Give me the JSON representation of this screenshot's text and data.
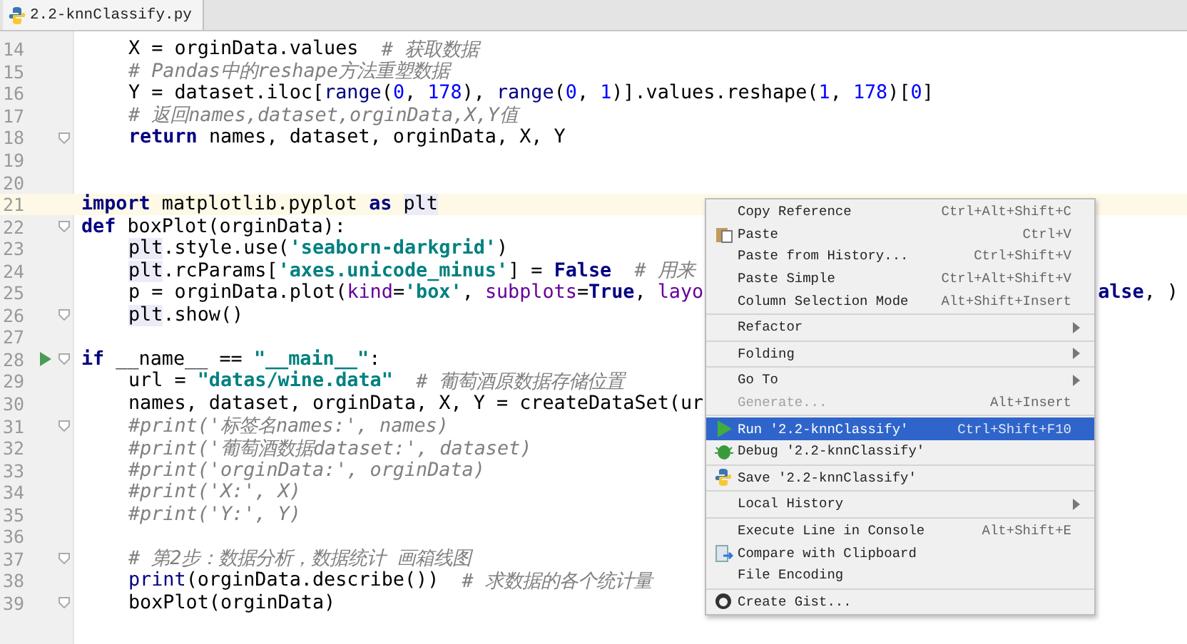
{
  "tabs": [
    {
      "label": "2.2-knnClassify.py",
      "selected": true
    }
  ],
  "editor": {
    "lines": [
      {
        "number": "14",
        "indented": true,
        "fold": false,
        "run": false,
        "current": false,
        "tokens": [
          {
            "kind": "plain",
            "text": "X = orginData.values  "
          },
          {
            "kind": "comment",
            "text": "# 获取数据"
          }
        ]
      },
      {
        "number": "15",
        "indented": true,
        "fold": false,
        "run": false,
        "current": false,
        "tokens": [
          {
            "kind": "comment",
            "text": "# Pandas中的reshape方法重塑数据"
          }
        ]
      },
      {
        "number": "16",
        "indented": true,
        "fold": false,
        "run": false,
        "current": false,
        "tokens": [
          {
            "kind": "plain",
            "text": "Y = dataset.iloc["
          },
          {
            "kind": "builtin",
            "text": "range"
          },
          {
            "kind": "plain",
            "text": "("
          },
          {
            "kind": "number",
            "text": "0"
          },
          {
            "kind": "plain",
            "text": ", "
          },
          {
            "kind": "number",
            "text": "178"
          },
          {
            "kind": "plain",
            "text": "), "
          },
          {
            "kind": "builtin",
            "text": "range"
          },
          {
            "kind": "plain",
            "text": "("
          },
          {
            "kind": "number",
            "text": "0"
          },
          {
            "kind": "plain",
            "text": ", "
          },
          {
            "kind": "number",
            "text": "1"
          },
          {
            "kind": "plain",
            "text": ")].values.reshape("
          },
          {
            "kind": "number",
            "text": "1"
          },
          {
            "kind": "plain",
            "text": ", "
          },
          {
            "kind": "number",
            "text": "178"
          },
          {
            "kind": "plain",
            "text": ")["
          },
          {
            "kind": "number",
            "text": "0"
          },
          {
            "kind": "plain",
            "text": "]"
          }
        ]
      },
      {
        "number": "17",
        "indented": true,
        "fold": false,
        "run": false,
        "current": false,
        "tokens": [
          {
            "kind": "comment",
            "text": "# 返回names,dataset,orginData,X,Y值"
          }
        ]
      },
      {
        "number": "18",
        "indented": true,
        "fold": true,
        "run": false,
        "current": false,
        "tokens": [
          {
            "kind": "keyword",
            "text": "return "
          },
          {
            "kind": "plain",
            "text": "names, dataset, orginData, X, Y"
          }
        ]
      },
      {
        "number": "19",
        "fold": false,
        "run": false,
        "current": false
      },
      {
        "number": "20",
        "fold": false,
        "run": false,
        "current": false
      },
      {
        "number": "21",
        "indented": false,
        "fold": false,
        "run": false,
        "current": true,
        "tokens": [
          {
            "kind": "keyword",
            "text": "import"
          },
          {
            "kind": "plain",
            "text": " matplotlib.pyplot "
          },
          {
            "kind": "keyword",
            "text": "as "
          },
          {
            "kind": "usage",
            "text": "plt"
          }
        ]
      },
      {
        "number": "22",
        "indented": false,
        "fold": true,
        "run": false,
        "current": false,
        "tokens": [
          {
            "kind": "keyword",
            "text": "def"
          },
          {
            "kind": "plain",
            "text": " boxPlot(orginData):"
          }
        ]
      },
      {
        "number": "23",
        "indented": true,
        "fold": false,
        "run": false,
        "current": false,
        "tokens": [
          {
            "kind": "usage",
            "text": "plt"
          },
          {
            "kind": "plain",
            "text": ".style.use("
          },
          {
            "kind": "string",
            "text": "'seaborn-darkgrid'"
          },
          {
            "kind": "plain",
            "text": ")"
          }
        ]
      },
      {
        "number": "24",
        "indented": true,
        "fold": false,
        "run": false,
        "current": false,
        "tokens": [
          {
            "kind": "usage",
            "text": "plt"
          },
          {
            "kind": "plain",
            "text": ".rcParams["
          },
          {
            "kind": "string",
            "text": "'axes.unicode_minus'"
          },
          {
            "kind": "plain",
            "text": "] = "
          },
          {
            "kind": "keyword",
            "text": "False  "
          },
          {
            "kind": "comment",
            "text": "# 用来"
          }
        ]
      },
      {
        "number": "25",
        "indented": true,
        "fold": false,
        "run": false,
        "current": false,
        "tokens": [
          {
            "kind": "plain",
            "text": "p = orginData.plot("
          },
          {
            "kind": "param",
            "text": "kind"
          },
          {
            "kind": "plain",
            "text": "="
          },
          {
            "kind": "string",
            "text": "'box'"
          },
          {
            "kind": "plain",
            "text": ", "
          },
          {
            "kind": "param",
            "text": "subplots"
          },
          {
            "kind": "plain",
            "text": "="
          },
          {
            "kind": "keyword",
            "text": "True"
          },
          {
            "kind": "plain",
            "text": ", "
          },
          {
            "kind": "param",
            "text": "layo"
          }
        ],
        "tail": [
          {
            "kind": "keyword",
            "text": "alse"
          },
          {
            "kind": "plain",
            "text": ", )"
          }
        ]
      },
      {
        "number": "26",
        "indented": true,
        "fold": true,
        "run": false,
        "current": false,
        "tokens": [
          {
            "kind": "usage",
            "text": "plt"
          },
          {
            "kind": "plain",
            "text": ".show()"
          }
        ]
      },
      {
        "number": "27",
        "fold": false,
        "run": false,
        "current": false
      },
      {
        "number": "28",
        "indented": false,
        "fold": true,
        "run": true,
        "current": false,
        "tokens": [
          {
            "kind": "keyword",
            "text": "if"
          },
          {
            "kind": "plain",
            "text": " __name__ == "
          },
          {
            "kind": "string",
            "text": "\"__main__\""
          },
          {
            "kind": "plain",
            "text": ":"
          }
        ]
      },
      {
        "number": "29",
        "indented": true,
        "fold": false,
        "run": false,
        "current": false,
        "tokens": [
          {
            "kind": "plain",
            "text": "url = "
          },
          {
            "kind": "string",
            "text": "\"datas/wine.data\"  "
          },
          {
            "kind": "comment",
            "text": "# 葡萄酒原数据存储位置"
          }
        ]
      },
      {
        "number": "30",
        "indented": true,
        "fold": false,
        "run": false,
        "current": false,
        "tokens": [
          {
            "kind": "plain",
            "text": "names, dataset, orginData, X, Y = createDataSet(ur"
          }
        ]
      },
      {
        "number": "31",
        "indented": true,
        "fold": true,
        "run": false,
        "current": false,
        "tokens": [
          {
            "kind": "comment",
            "text": "#print('标签名names:', names)"
          }
        ]
      },
      {
        "number": "32",
        "indented": true,
        "fold": false,
        "run": false,
        "current": false,
        "tokens": [
          {
            "kind": "comment",
            "text": "#print('葡萄酒数据dataset:', dataset)"
          }
        ]
      },
      {
        "number": "33",
        "indented": true,
        "fold": false,
        "run": false,
        "current": false,
        "tokens": [
          {
            "kind": "comment",
            "text": "#print('orginData:', orginData)"
          }
        ]
      },
      {
        "number": "34",
        "indented": true,
        "fold": false,
        "run": false,
        "current": false,
        "tokens": [
          {
            "kind": "comment",
            "text": "#print('X:', X)"
          }
        ]
      },
      {
        "number": "35",
        "indented": true,
        "fold": false,
        "run": false,
        "current": false,
        "tokens": [
          {
            "kind": "comment",
            "text": "#print('Y:', Y)"
          }
        ]
      },
      {
        "number": "36",
        "fold": false,
        "run": false,
        "current": false
      },
      {
        "number": "37",
        "indented": true,
        "fold": true,
        "run": false,
        "current": false,
        "tokens": [
          {
            "kind": "comment",
            "text": "# 第2步：数据分析，数据统计 画箱线图"
          }
        ]
      },
      {
        "number": "38",
        "indented": true,
        "fold": false,
        "run": false,
        "current": false,
        "tokens": [
          {
            "kind": "builtin",
            "text": "print"
          },
          {
            "kind": "plain",
            "text": "(orginData.describe())  "
          },
          {
            "kind": "comment",
            "text": "# 求数据的各个统计量"
          }
        ]
      },
      {
        "number": "39",
        "indented": true,
        "fold": true,
        "run": false,
        "current": false,
        "tokens": [
          {
            "kind": "plain",
            "text": "boxPlot(orginData)"
          }
        ]
      }
    ]
  },
  "context_menu": {
    "items": [
      {
        "kind": "plain",
        "label": "Copy Reference",
        "shortcut": "Ctrl+Alt+Shift+C",
        "submenu": false,
        "disabled": false,
        "selected": false
      },
      {
        "kind": "paste",
        "label": "Paste",
        "shortcut": "Ctrl+V",
        "submenu": false,
        "disabled": false,
        "selected": false
      },
      {
        "kind": "plain",
        "label": "Paste from History...",
        "shortcut": "Ctrl+Shift+V",
        "submenu": false,
        "disabled": false,
        "selected": false
      },
      {
        "kind": "plain",
        "label": "Paste Simple",
        "shortcut": "Ctrl+Alt+Shift+V",
        "submenu": false,
        "disabled": false,
        "selected": false
      },
      {
        "kind": "plain",
        "label": "Column Selection Mode",
        "shortcut": "Alt+Shift+Insert",
        "submenu": false,
        "disabled": false,
        "selected": false
      },
      {
        "kind": "separator"
      },
      {
        "kind": "plain",
        "label": "Refactor",
        "submenu": true,
        "disabled": false,
        "selected": false
      },
      {
        "kind": "separator"
      },
      {
        "kind": "plain",
        "label": "Folding",
        "submenu": true,
        "disabled": false,
        "selected": false
      },
      {
        "kind": "separator"
      },
      {
        "kind": "plain",
        "label": "Go To",
        "submenu": true,
        "disabled": false,
        "selected": false
      },
      {
        "kind": "plain",
        "label": "Generate...",
        "shortcut": "Alt+Insert",
        "submenu": false,
        "disabled": true,
        "selected": false
      },
      {
        "kind": "separator"
      },
      {
        "kind": "run",
        "label": "Run '2.2-knnClassify'",
        "shortcut": "Ctrl+Shift+F10",
        "submenu": false,
        "disabled": false,
        "selected": true
      },
      {
        "kind": "debug",
        "label": "Debug '2.2-knnClassify'",
        "submenu": false,
        "disabled": false,
        "selected": false
      },
      {
        "kind": "separator"
      },
      {
        "kind": "python",
        "label": "Save '2.2-knnClassify'",
        "submenu": false,
        "disabled": false,
        "selected": false
      },
      {
        "kind": "separator"
      },
      {
        "kind": "plain",
        "label": "Local History",
        "submenu": true,
        "disabled": false,
        "selected": false
      },
      {
        "kind": "separator"
      },
      {
        "kind": "plain",
        "label": "Execute Line in Console",
        "shortcut": "Alt+Shift+E",
        "submenu": false,
        "disabled": false,
        "selected": false
      },
      {
        "kind": "compare",
        "label": "Compare with Clipboard",
        "submenu": false,
        "disabled": false,
        "selected": false
      },
      {
        "kind": "plain",
        "label": "File Encoding",
        "submenu": false,
        "disabled": false,
        "selected": false
      },
      {
        "kind": "separator"
      },
      {
        "kind": "gist",
        "label": "Create Gist...",
        "submenu": false,
        "disabled": false,
        "selected": false
      }
    ]
  }
}
